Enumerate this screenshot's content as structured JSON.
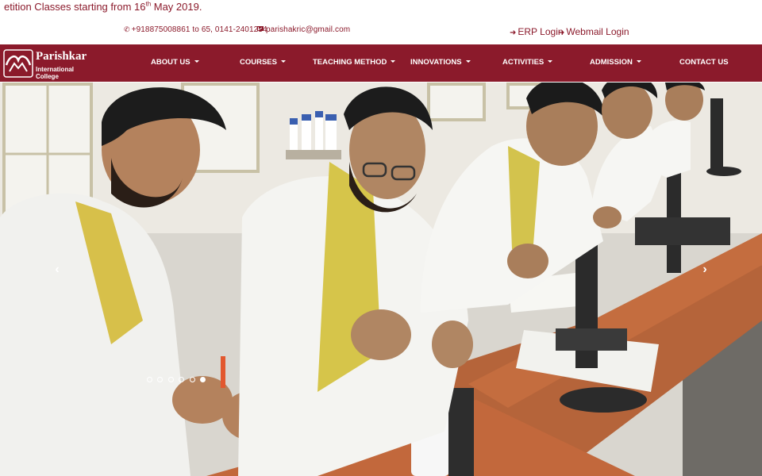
{
  "announcement": {
    "prefix": "etition Classes starting from 16",
    "sup": "th",
    "suffix": " May 2019."
  },
  "contact": {
    "phone": "+918875008861 to 65, 0141-2401234",
    "phone_icon": "phone-icon",
    "email": "parishakric@gmail.com",
    "email_icon": "envelope-icon"
  },
  "logins": {
    "erp": "ERP Login",
    "webmail": "Webmail Login",
    "icon": "sign-in-icon"
  },
  "brand": {
    "name": "Parishkar",
    "tagline": "International College"
  },
  "nav": {
    "items": [
      {
        "label": "ABOUT US",
        "dropdown": true
      },
      {
        "label": "COURSES",
        "dropdown": true
      },
      {
        "label": "TEACHING METHOD",
        "dropdown": true
      },
      {
        "label": "INNOVATIONS",
        "dropdown": true
      },
      {
        "label": "ACTIVITIES",
        "dropdown": true
      },
      {
        "label": "ADMISSION",
        "dropdown": true
      },
      {
        "label": "CONTACT US",
        "dropdown": false
      }
    ]
  },
  "slider": {
    "prev_glyph": "‹",
    "next_glyph": "›",
    "slide_count": 6,
    "active_slide": 6
  },
  "colors": {
    "brand": "#8b1a2b",
    "nav_text": "#ffffff"
  }
}
